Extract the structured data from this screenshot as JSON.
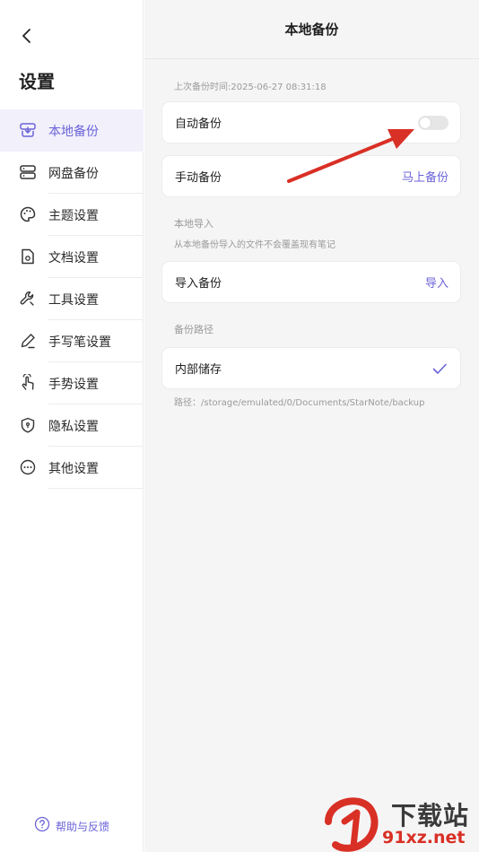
{
  "sidebar": {
    "title": "设置",
    "items": [
      {
        "label": "本地备份",
        "icon": "local-backup-icon",
        "active": true
      },
      {
        "label": "网盘备份",
        "icon": "cloud-drive-icon",
        "active": false
      },
      {
        "label": "主题设置",
        "icon": "palette-icon",
        "active": false
      },
      {
        "label": "文档设置",
        "icon": "document-gear-icon",
        "active": false
      },
      {
        "label": "工具设置",
        "icon": "wrench-icon",
        "active": false
      },
      {
        "label": "手写笔设置",
        "icon": "pen-icon",
        "active": false
      },
      {
        "label": "手势设置",
        "icon": "hand-gesture-icon",
        "active": false
      },
      {
        "label": "隐私设置",
        "icon": "shield-icon",
        "active": false
      },
      {
        "label": "其他设置",
        "icon": "more-dots-icon",
        "active": false
      }
    ],
    "help_label": "帮助与反馈"
  },
  "main": {
    "title": "本地备份",
    "last_backup": "上次备份时间:2025-06-27 08:31:18",
    "auto_backup": {
      "label": "自动备份",
      "enabled": false
    },
    "manual_backup": {
      "label": "手动备份",
      "action": "马上备份"
    },
    "import_section": {
      "title": "本地导入",
      "note": "从本地备份导入的文件不会覆盖现有笔记"
    },
    "import_backup": {
      "label": "导入备份",
      "action": "导入"
    },
    "path_section": {
      "title": "备份路径"
    },
    "internal_storage": {
      "label": "内部储存",
      "selected": true
    },
    "path_text": "路径：/storage/emulated/0/Documents/StarNote/backup"
  },
  "watermark": {
    "line1": "下载站",
    "line2": "91xz.net"
  },
  "colors": {
    "accent": "#6b63d8",
    "annotation_arrow": "#d93026",
    "active_bg": "#f1f0fb"
  }
}
